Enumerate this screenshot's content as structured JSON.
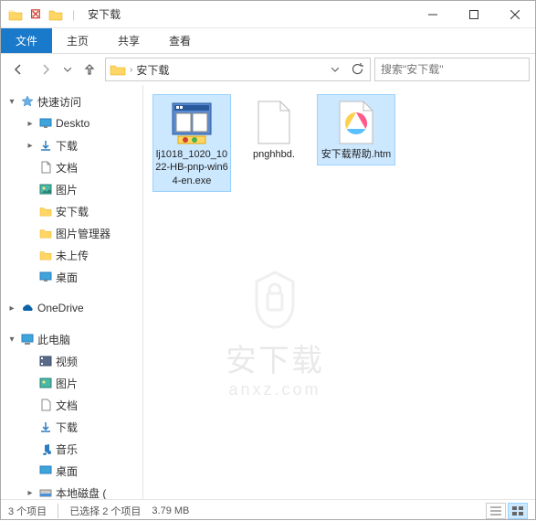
{
  "titlebar": {
    "title": "安下载"
  },
  "ribbon": {
    "tabs": [
      "文件",
      "主页",
      "共享",
      "查看"
    ]
  },
  "address": {
    "path": "安下载"
  },
  "search": {
    "placeholder": "搜索\"安下载\""
  },
  "sidebar": {
    "quick_access": "快速访问",
    "items": [
      {
        "label": "Deskto"
      },
      {
        "label": "下载"
      },
      {
        "label": "文档"
      },
      {
        "label": "图片"
      },
      {
        "label": "安下载"
      },
      {
        "label": "图片管理器"
      },
      {
        "label": "未上传"
      },
      {
        "label": "桌面"
      }
    ],
    "onedrive": "OneDrive",
    "this_pc": "此电脑",
    "pc_items": [
      {
        "label": "视频"
      },
      {
        "label": "图片"
      },
      {
        "label": "文档"
      },
      {
        "label": "下载"
      },
      {
        "label": "音乐"
      },
      {
        "label": "桌面"
      },
      {
        "label": "本地磁盘 ("
      }
    ]
  },
  "files": [
    {
      "name": "lj1018_1020_1022-HB-pnp-win64-en.exe",
      "selected": true,
      "type": "exe"
    },
    {
      "name": "pnghhbd.",
      "selected": false,
      "type": "blank"
    },
    {
      "name": "安下载帮助.htm",
      "selected": true,
      "type": "htm"
    }
  ],
  "statusbar": {
    "count": "3 个项目",
    "selection": "已选择 2 个项目",
    "size": "3.79 MB"
  },
  "watermark": {
    "main": "安下载",
    "sub": "anxz.com"
  }
}
